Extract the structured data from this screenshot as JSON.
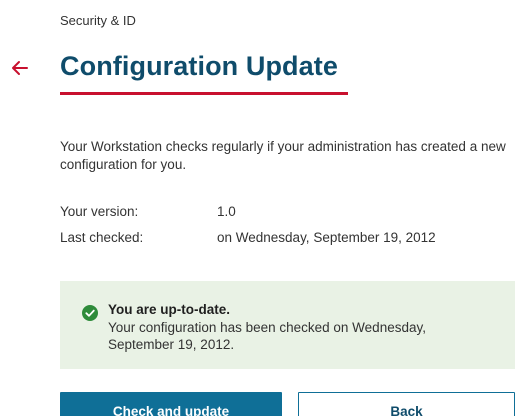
{
  "header": {
    "breadcrumb": "Security & ID",
    "title": "Configuration Update"
  },
  "main": {
    "description": "Your Workstation checks regularly if your administration has created a new configuration for you.",
    "info": [
      {
        "label": "Your version:",
        "value": "1.0"
      },
      {
        "label": "Last checked:",
        "value": "on Wednesday, September 19, 2012"
      }
    ],
    "status": {
      "title": "You are up-to-date.",
      "text": "Your configuration has been checked on Wednesday, September 19, 2012."
    }
  },
  "actions": {
    "primary_label": "Check and update",
    "secondary_label": "Back"
  },
  "colors": {
    "accent": "#c8102e",
    "title": "#0f4c6b",
    "primary_button": "#0f6f97",
    "status_background": "#e9f2e5",
    "success_icon": "#2e8b3a"
  },
  "icons": {
    "back": "back-arrow-icon",
    "status": "checkmark-circle-icon"
  }
}
